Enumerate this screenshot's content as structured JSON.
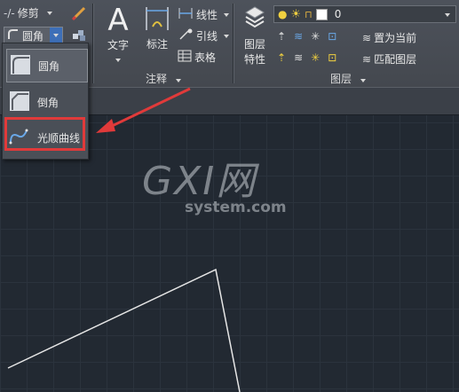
{
  "ribbon": {
    "modify": {
      "trim_label": "修剪",
      "fillet_label": "圆角"
    },
    "annotation": {
      "text_label": "文字",
      "dimension_label": "标注",
      "linear_label": "线性",
      "leader_label": "引线",
      "table_label": "表格",
      "panel_title": "注释"
    },
    "layers": {
      "properties_label_1": "图层",
      "properties_label_2": "特性",
      "current_layer": "0",
      "set_current_label": "置为当前",
      "match_layer_label": "匹配图层",
      "panel_title": "图层"
    }
  },
  "dropdown": {
    "items": [
      {
        "label": "圆角"
      },
      {
        "label": "倒角"
      },
      {
        "label": "光顺曲线"
      }
    ]
  },
  "watermark": {
    "logo": "GXI网",
    "domain": "system.com"
  },
  "colors": {
    "highlight": "#e03a3a",
    "canvas": "#222932",
    "ribbon": "#4a4f57"
  }
}
